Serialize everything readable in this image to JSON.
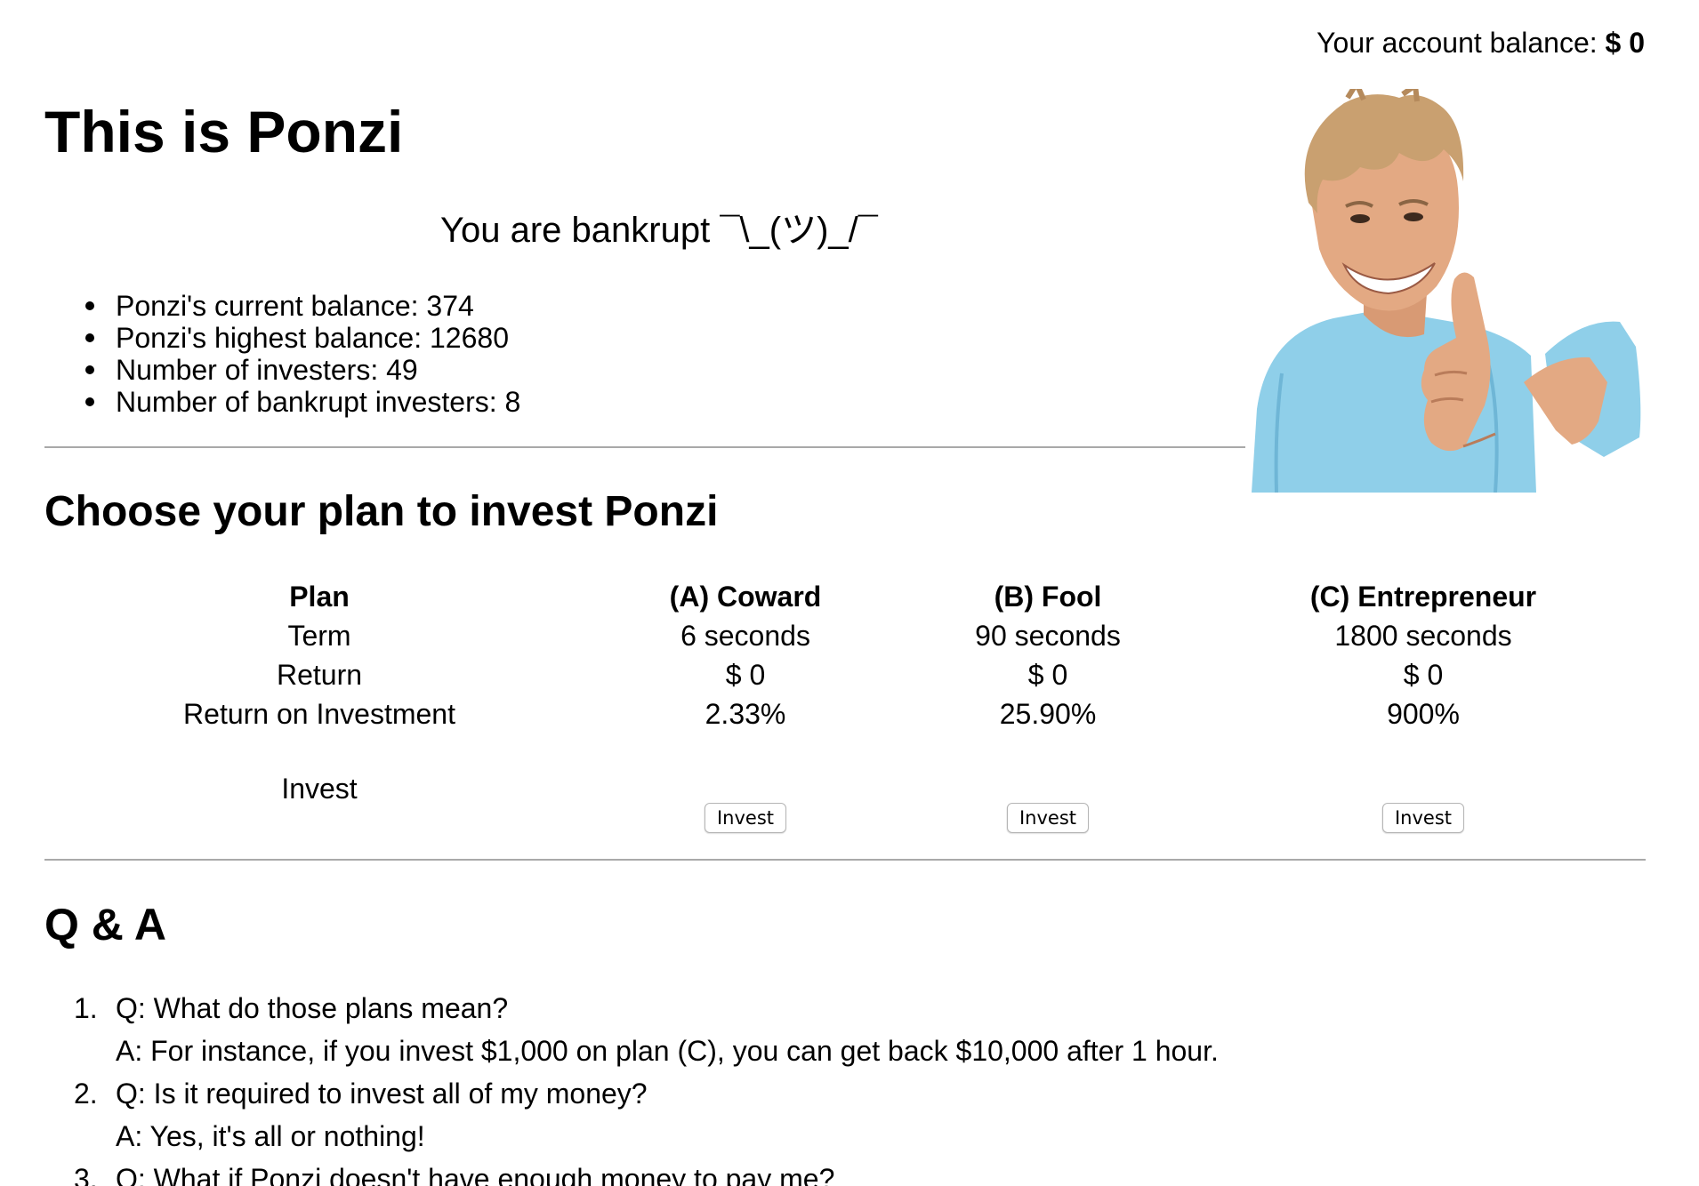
{
  "header": {
    "balance_label": "Your account balance:",
    "balance_value": "$ 0"
  },
  "page_title": "This is Ponzi",
  "status": "You are bankrupt ¯\\_(ツ)_/¯",
  "stats": [
    "Ponzi's current balance: 374",
    "Ponzi's highest balance: 12680",
    "Number of investers: 49",
    "Number of bankrupt investers: 8"
  ],
  "plans_title": "Choose your plan to invest Ponzi",
  "plan_table": {
    "row_labels": {
      "plan": "Plan",
      "term": "Term",
      "return": "Return",
      "roi": "Return on Investment",
      "invest": "Invest"
    },
    "plans": [
      {
        "name": "(A) Coward",
        "term": "6 seconds",
        "return": "$ 0",
        "roi": "2.33%",
        "button": "Invest"
      },
      {
        "name": "(B) Fool",
        "term": "90 seconds",
        "return": "$ 0",
        "roi": "25.90%",
        "button": "Invest"
      },
      {
        "name": "(C) Entrepreneur",
        "term": "1800 seconds",
        "return": "$ 0",
        "roi": "900%",
        "button": "Invest"
      }
    ]
  },
  "qa_title": "Q & A",
  "qa": [
    {
      "num": "1.",
      "q": "Q: What do those plans mean?",
      "a": "A: For instance, if you invest $1,000 on plan (C), you can get back $10,000 after 1 hour."
    },
    {
      "num": "2.",
      "q": "Q: Is it required to invest all of my money?",
      "a": "A: Yes, it's all or nothing!"
    },
    {
      "num": "3.",
      "q": "Q: What if Ponzi doesn't have enough money to pay me?"
    }
  ],
  "hero_image": {
    "icon": "smiling-man-thumbs-up-photo",
    "colors": {
      "shirt": "#8fcfe9",
      "skin": "#e3a983",
      "hair": "#c9a070"
    }
  }
}
